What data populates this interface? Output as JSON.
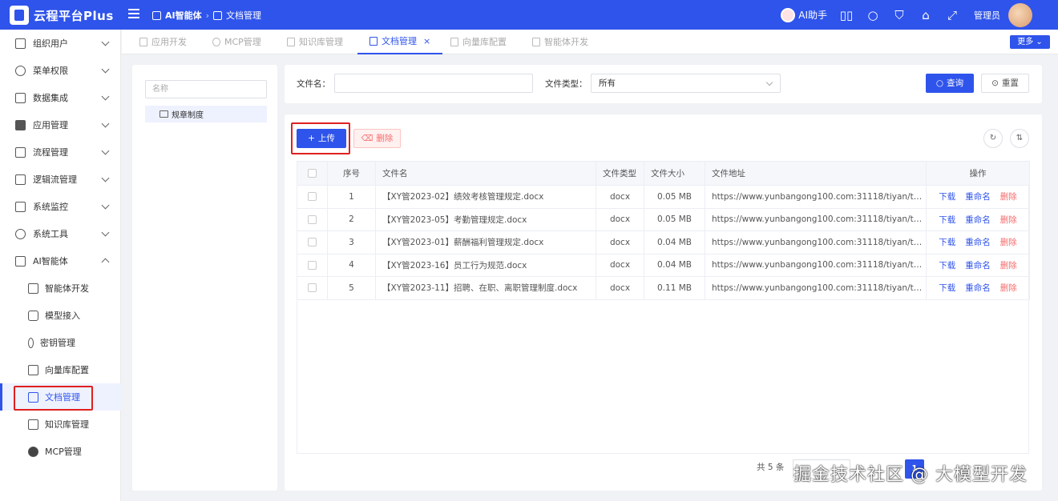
{
  "app": {
    "title": "云程平台Plus"
  },
  "breadcrumb": {
    "level1": "AI智能体",
    "level2": "文档管理"
  },
  "header": {
    "assistant_label": "AI助手",
    "user_label": "管理员"
  },
  "sidebar": {
    "items": [
      {
        "label": "组织用户",
        "icon": "building-icon"
      },
      {
        "label": "菜单权限",
        "icon": "settings-circle-icon"
      },
      {
        "label": "数据集成",
        "icon": "briefcase-icon"
      },
      {
        "label": "应用管理",
        "icon": "apps-grid-icon"
      },
      {
        "label": "流程管理",
        "icon": "flow-chart-icon"
      },
      {
        "label": "逻辑流管理",
        "icon": "logic-flow-icon"
      },
      {
        "label": "系统监控",
        "icon": "monitor-icon"
      },
      {
        "label": "系统工具",
        "icon": "gear-icon"
      },
      {
        "label": "AI智能体",
        "icon": "cube-icon"
      }
    ],
    "subitems": [
      {
        "label": "智能体开发",
        "icon": "image-icon"
      },
      {
        "label": "模型接入",
        "icon": "hexagon-icon"
      },
      {
        "label": "密钥管理",
        "icon": "key-icon"
      },
      {
        "label": "向量库配置",
        "icon": "crop-icon"
      },
      {
        "label": "文档管理",
        "icon": "document-icon"
      },
      {
        "label": "知识库管理",
        "icon": "book-icon"
      },
      {
        "label": "MCP管理",
        "icon": "gear-icon"
      }
    ]
  },
  "tabs": [
    {
      "label": "应用开发"
    },
    {
      "label": "MCP管理"
    },
    {
      "label": "知识库管理"
    },
    {
      "label": "文档管理",
      "close": "×"
    },
    {
      "label": "向量库配置"
    },
    {
      "label": "智能体开发"
    }
  ],
  "more_button": "更多 ⌄",
  "tree": {
    "search_placeholder": "名称",
    "node": "规章制度"
  },
  "filters": {
    "filename_label": "文件名：",
    "filename_value": "",
    "filetype_label": "文件类型：",
    "filetype_value": "所有",
    "query_button": "查询",
    "reset_button": "重置"
  },
  "toolbar": {
    "upload_button": "上传",
    "delete_button": "删除"
  },
  "table": {
    "headers": {
      "index": "序号",
      "filename": "文件名",
      "filetype": "文件类型",
      "filesize": "文件大小",
      "url": "文件地址",
      "actions": "操作"
    },
    "rows": [
      {
        "index": "1",
        "filename": "【XY管2023-02】绩效考核管理规定.docx",
        "filetype": "docx",
        "filesize": "0.05 MB",
        "url": "https://www.yunbangong100.com:31118/tiyan/temp/...",
        "download": "下载",
        "rename": "重命名",
        "delete": "删除"
      },
      {
        "index": "2",
        "filename": "【XY管2023-05】考勤管理规定.docx",
        "filetype": "docx",
        "filesize": "0.05 MB",
        "url": "https://www.yunbangong100.com:31118/tiyan/temp/...",
        "download": "下载",
        "rename": "重命名",
        "delete": "删除"
      },
      {
        "index": "3",
        "filename": "【XY管2023-01】薪酬福利管理规定.docx",
        "filetype": "docx",
        "filesize": "0.04 MB",
        "url": "https://www.yunbangong100.com:31118/tiyan/temp/...",
        "download": "下载",
        "rename": "重命名",
        "delete": "删除"
      },
      {
        "index": "4",
        "filename": "【XY管2023-16】员工行为规范.docx",
        "filetype": "docx",
        "filesize": "0.04 MB",
        "url": "https://www.yunbangong100.com:31118/tiyan/temp/...",
        "download": "下载",
        "rename": "重命名",
        "delete": "删除"
      },
      {
        "index": "5",
        "filename": "【XY管2023-11】招聘、在职、离职管理制度.docx",
        "filetype": "docx",
        "filesize": "0.11 MB",
        "url": "https://www.yunbangong100.com:31118/tiyan/temp/...",
        "download": "下载",
        "rename": "重命名",
        "delete": "删除"
      }
    ]
  },
  "pagination": {
    "total_text": "共 5 条",
    "current_page": "1"
  },
  "watermark": "掘金技术社区 @ 大模型开发",
  "colors": {
    "primary": "#2f54eb",
    "danger": "#f56c6c",
    "highlight_box": "#e02020"
  }
}
